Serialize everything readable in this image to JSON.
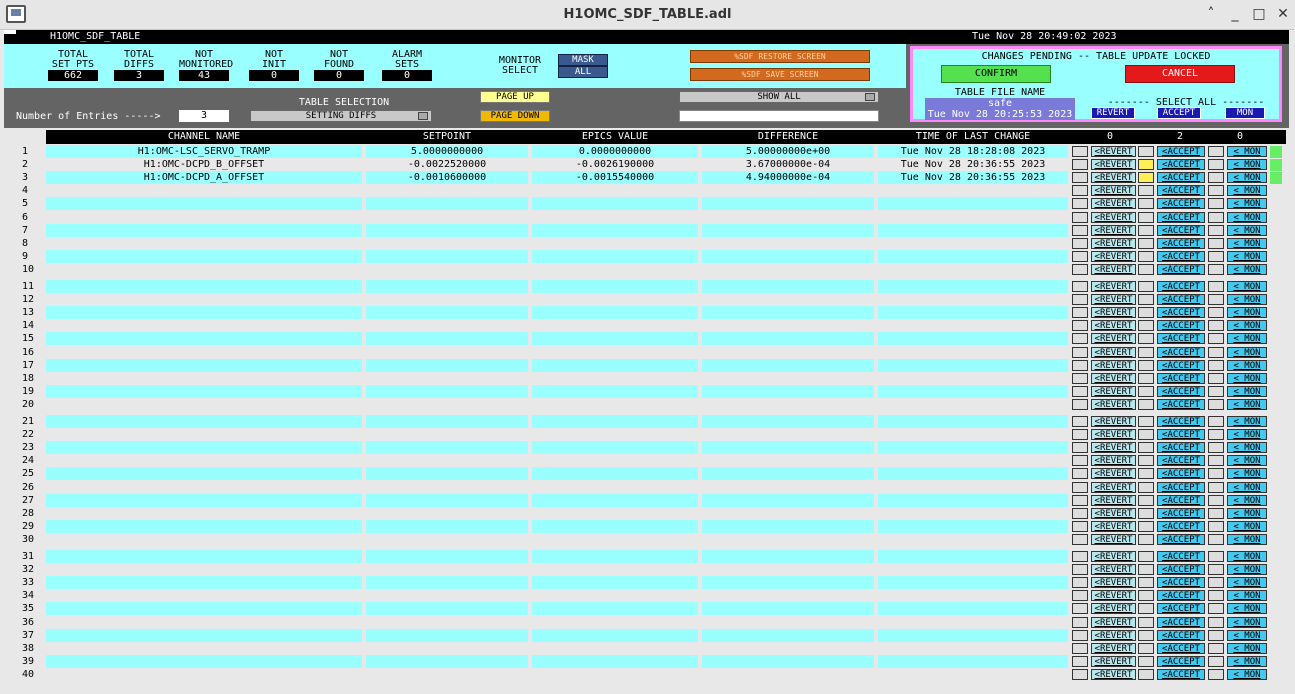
{
  "window": {
    "title": "H1OMC_SDF_TABLE.adl"
  },
  "header": {
    "screen_name": "H1OMC_SDF_TABLE",
    "timestamp": "Tue Nov 28 20:49:02 2023"
  },
  "stats": [
    {
      "label": "TOTAL\nSET PTS",
      "value": "662"
    },
    {
      "label": "TOTAL\nDIFFS",
      "value": "3"
    },
    {
      "label": "NOT\nMONITORED",
      "value": "43"
    },
    {
      "label": "NOT\nINIT",
      "value": "0"
    },
    {
      "label": "NOT\nFOUND",
      "value": "0"
    },
    {
      "label": "ALARM\nSETS",
      "value": "0"
    }
  ],
  "monitor": {
    "label": "MONITOR\nSELECT",
    "mask": "MASK",
    "all": "ALL"
  },
  "buttons": {
    "restore": "%SDF RESTORE SCREEN",
    "save": "%SDF SAVE SCREEN",
    "show_all": "SHOW ALL"
  },
  "pending": {
    "text": "CHANGES PENDING -- TABLE UPDATE LOCKED",
    "confirm": "CONFIRM",
    "cancel": "CANCEL",
    "file_label": "TABLE FILE NAME",
    "file_name": "safe",
    "file_time": "Tue Nov 28 20:25:53 2023",
    "select_all_label": "------- SELECT ALL -------",
    "revert": "REVERT",
    "accept": "ACCEPT",
    "mon": "MON"
  },
  "entries": {
    "label": "Number of Entries ----->",
    "value": "3"
  },
  "table_selection": {
    "label": "TABLE SELECTION",
    "value": "SETTING DIFFS"
  },
  "paging": {
    "up": "PAGE UP",
    "down": "PAGE DOWN"
  },
  "columns": {
    "channel": "CHANNEL NAME",
    "setpoint": "SETPOINT",
    "epics": "EPICS VALUE",
    "diff": "DIFFERENCE",
    "time": "TIME OF LAST CHANGE",
    "count_revert": "0",
    "count_accept": "2",
    "count_mon": "0"
  },
  "rows": [
    {
      "channel": "H1:OMC-LSC_SERVO_TRAMP",
      "setpoint": "5.0000000000",
      "epics": "0.0000000000",
      "diff": "5.00000000e+00",
      "time": "Tue Nov 28 18:28:08 2023"
    },
    {
      "channel": "H1:OMC-DCPD_B_OFFSET",
      "setpoint": "-0.0022520000",
      "epics": "-0.0026190000",
      "diff": "3.67000000e-04",
      "time": "Tue Nov 28 20:36:55 2023"
    },
    {
      "channel": "H1:OMC-DCPD_A_OFFSET",
      "setpoint": "-0.0010600000",
      "epics": "-0.0015540000",
      "diff": "4.94000000e-04",
      "time": "Tue Nov 28 20:36:55 2023"
    }
  ],
  "row_actions": {
    "revert": "<REVERT",
    "accept": "<ACCEPT",
    "mon": "< MON"
  },
  "row_count": 40,
  "colors": {
    "cyan": "#99ffff",
    "row_alt": "#e8e8e8",
    "green": "#55e050",
    "red": "#e41919",
    "pink": "#ff88ff"
  }
}
